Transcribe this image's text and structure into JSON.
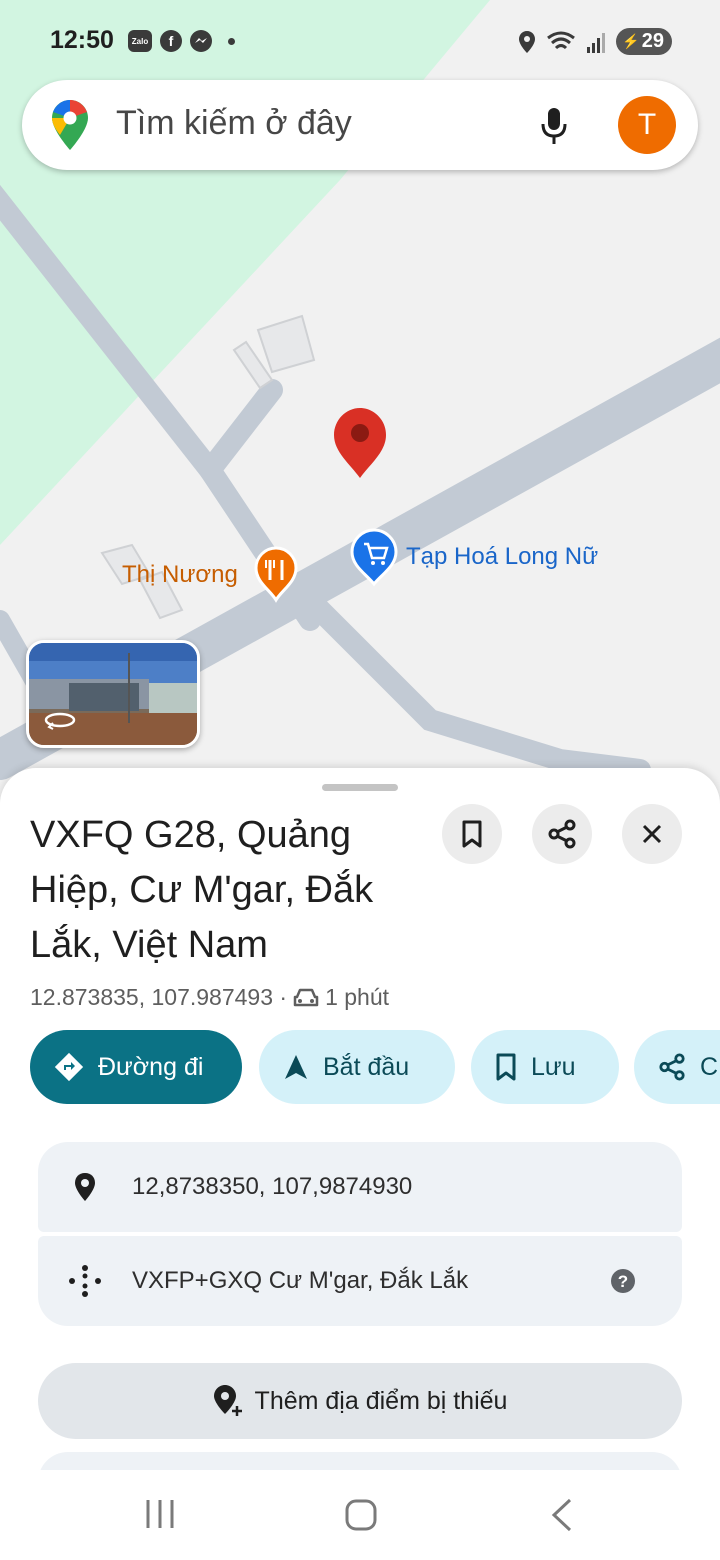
{
  "status_bar": {
    "time": "12:50",
    "zalo_label": "Zalo",
    "battery": "29",
    "icons": [
      "zalo-icon",
      "facebook-icon",
      "messenger-icon",
      "location-icon",
      "wifi-icon",
      "signal-icon",
      "battery-icon"
    ]
  },
  "search": {
    "placeholder": "Tìm kiếm ở đây",
    "avatar_initial": "T"
  },
  "map": {
    "pois": [
      {
        "name": "Thị Nương",
        "icon": "restaurant-icon",
        "color": "#ef6c00"
      },
      {
        "name": "Tạp Hoá Long Nữ",
        "icon": "shopping-cart-icon",
        "color": "#1a73e8"
      }
    ],
    "pin_color": "#d93025"
  },
  "place": {
    "title": "VXFQ G28, Quảng Hiệp, Cư M'gar, Đắk Lắk, Việt Nam",
    "coords": "12.873835, 107.987493 ·",
    "drive_time": "1 phút"
  },
  "actions": {
    "directions": "Đường đi",
    "start": "Bắt đầu",
    "save": "Lưu",
    "share_partial": "C"
  },
  "info": {
    "coordinates": "12,8738350, 107,9874930",
    "plus_code": "VXFP+GXQ Cư M'gar, Đắk Lắk"
  },
  "add_place": "Thêm địa điểm bị thiếu",
  "colors": {
    "primary_chip": "#0b7285",
    "light_chip": "#d4f1f9",
    "avatar": "#ef6c00"
  }
}
